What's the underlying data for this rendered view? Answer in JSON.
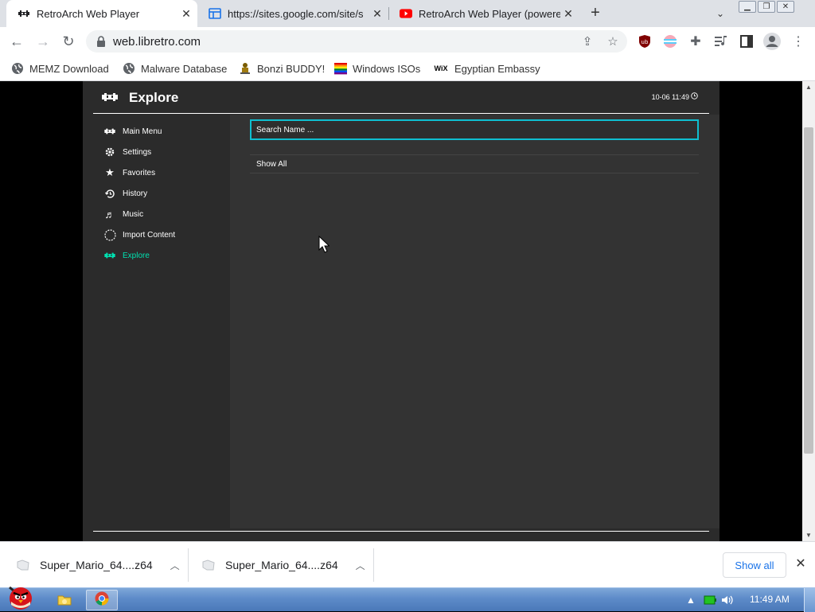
{
  "browser": {
    "tabs": [
      {
        "title": "RetroArch Web Player",
        "active": true
      },
      {
        "title": "https://sites.google.com/site/s",
        "active": false
      },
      {
        "title": "RetroArch Web Player (powere",
        "active": false
      }
    ],
    "url": "web.libretro.com",
    "bookmarks": [
      "MEMZ Download",
      "Malware Database",
      "Bonzi BUDDY!",
      "Windows ISOs",
      "Egyptian Embassy"
    ],
    "wix_label": "WiX"
  },
  "retroarch": {
    "title": "Explore",
    "clock": "10-06 11:49",
    "menu": [
      "Main Menu",
      "Settings",
      "Favorites",
      "History",
      "Music",
      "Import Content",
      "Explore"
    ],
    "active_color": "#00e0b0",
    "search_placeholder": "Search Name ...",
    "list": [
      "Show All"
    ]
  },
  "downloads": {
    "items": [
      "Super_Mario_64....z64",
      "Super_Mario_64....z64"
    ],
    "show_all": "Show all"
  },
  "taskbar": {
    "clock": "11:49 AM"
  }
}
